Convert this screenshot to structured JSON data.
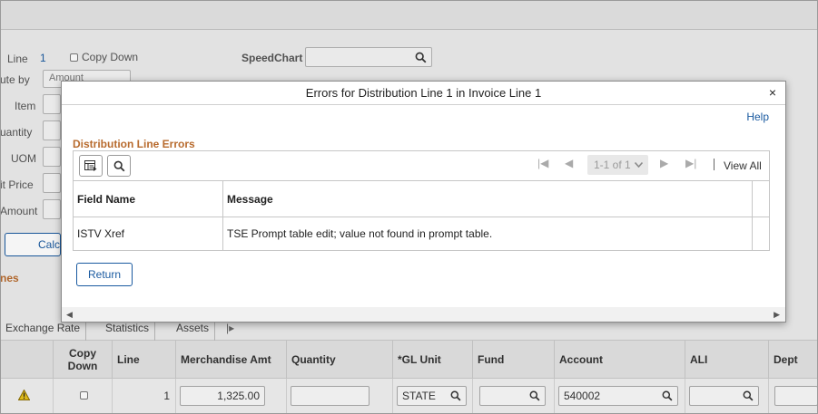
{
  "form": {
    "line_label": "Line",
    "line_value": "1",
    "copy_down_label": "Copy Down",
    "distribute_by_label": "ute by",
    "distribute_by_value": "Amount",
    "item_label": "Item",
    "quantity_label": "uantity",
    "uom_label": "UOM",
    "unit_price_label": "it Price",
    "amount_label": "Amount",
    "calc_button": "Calc",
    "section_fragment": "nes",
    "speedchart_label": "SpeedChart"
  },
  "tabs": [
    "Exchange Rate",
    "Statistics",
    "Assets"
  ],
  "grid": {
    "headers": [
      "Copy Down",
      "Line",
      "Merchandise Amt",
      "Quantity",
      "*GL Unit",
      "Fund",
      "Account",
      "ALI",
      "Dept"
    ],
    "row": {
      "line": "1",
      "merchandise_amt": "1,325.00",
      "quantity": "",
      "gl_unit": "STATE",
      "fund": "",
      "account": "540002",
      "ali": "",
      "dept": ""
    }
  },
  "modal": {
    "title": "Errors for Distribution Line 1 in Invoice Line 1",
    "close_label": "×",
    "help_label": "Help",
    "section_title": "Distribution Line Errors",
    "pager_text": "1-1 of 1",
    "view_all_label": "View All",
    "headers": [
      "Field Name",
      "Message"
    ],
    "rows": [
      {
        "field_name": "ISTV Xref",
        "message": "TSE Prompt table edit; value not found in prompt table."
      }
    ],
    "return_label": "Return"
  },
  "colors": {
    "link": "#1a5aa0",
    "section_title": "#b86b2e",
    "warning": "#e8c21a"
  },
  "icons": [
    "search-icon",
    "grid-settings-icon",
    "first-page-icon",
    "prev-page-icon",
    "next-page-icon",
    "last-page-icon",
    "chevron-down-icon",
    "warning-icon",
    "close-icon"
  ]
}
